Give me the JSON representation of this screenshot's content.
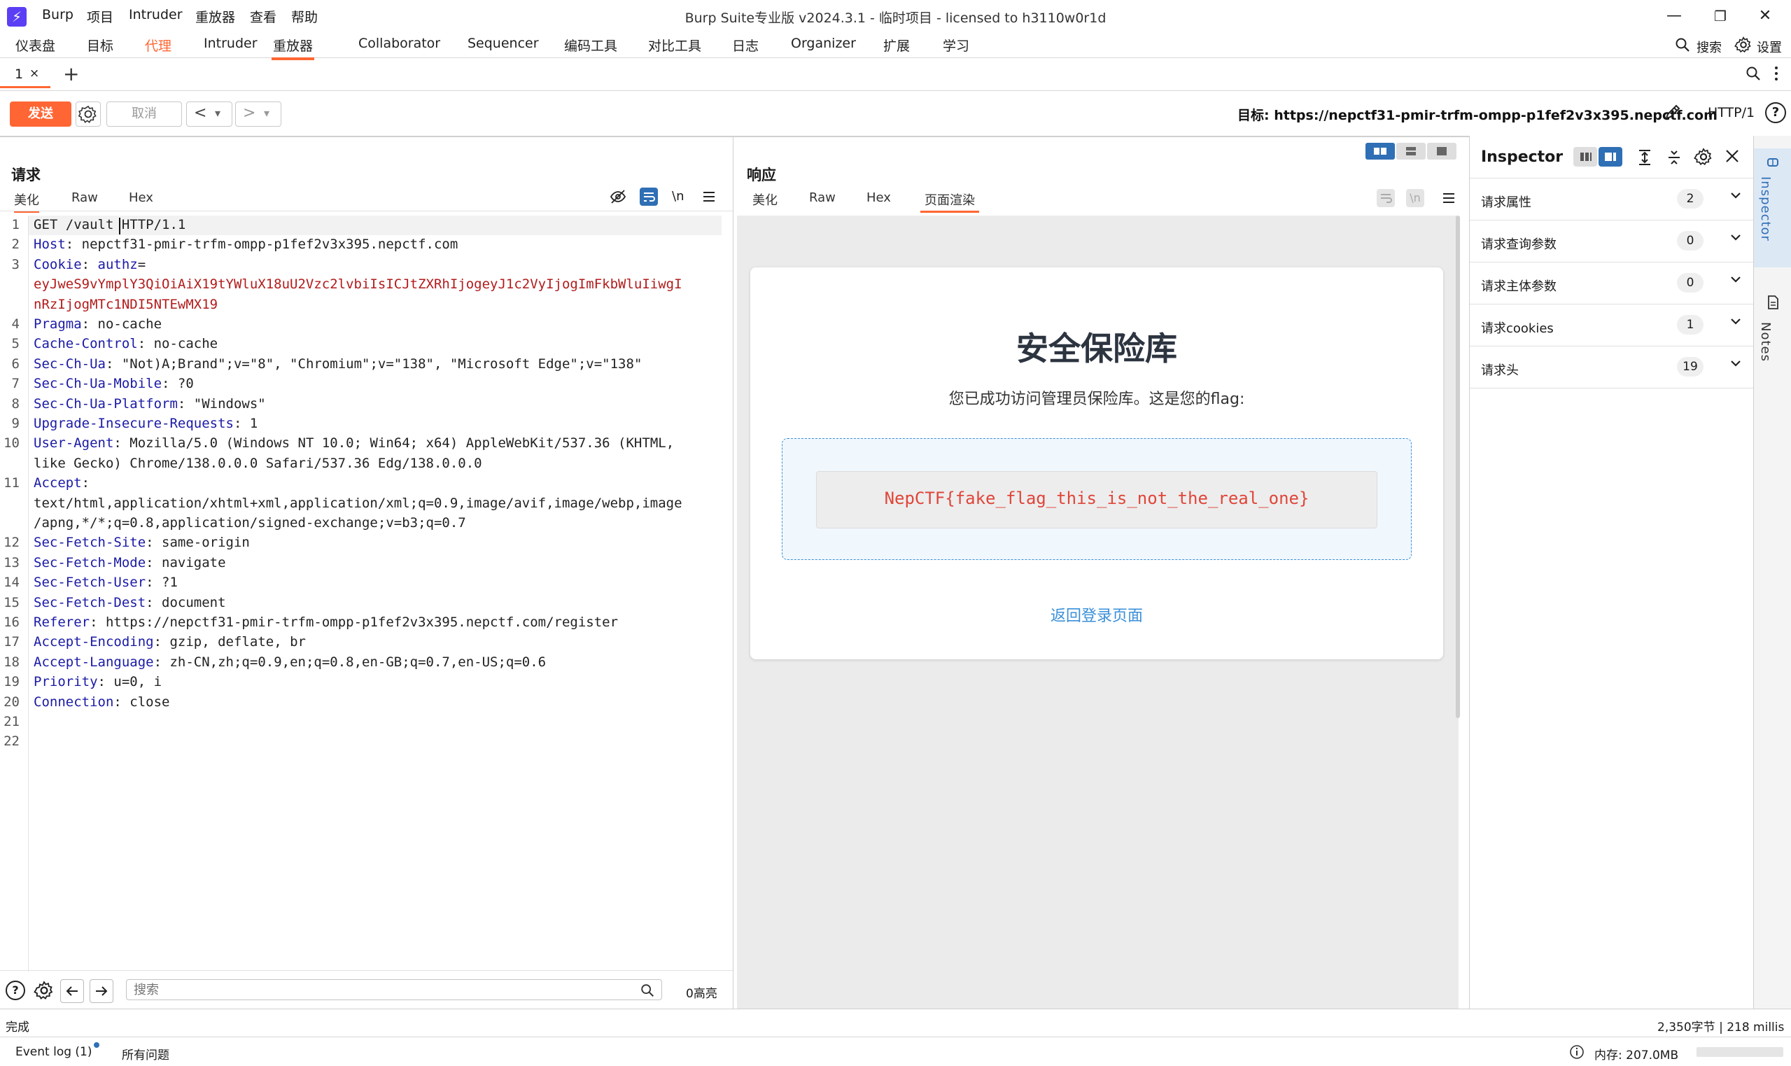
{
  "app": {
    "logo": "⚡",
    "window_title": "Burp Suite专业版  v2024.3.1 - 临时项目 - licensed to h3110w0r1d",
    "menu": [
      "Burp",
      "项目",
      "Intruder",
      "重放器",
      "查看",
      "帮助"
    ]
  },
  "window_controls": {
    "minimize": "—",
    "maximize": "❐",
    "close": "✕"
  },
  "main_tabs": {
    "items": [
      "仪表盘",
      "目标",
      "代理",
      "Intruder",
      "重放器",
      "Collaborator",
      "Sequencer",
      "编码工具",
      "对比工具",
      "日志",
      "Organizer",
      "扩展",
      "学习"
    ],
    "active": "重放器",
    "highlight": "代理",
    "search_label": "搜索",
    "settings_label": "设置"
  },
  "repeater_tabs": {
    "tab1": "1",
    "close": "×",
    "add": "+"
  },
  "toolbar": {
    "send": "发送",
    "cancel": "取消",
    "back": "<",
    "forward": ">",
    "dropdown": "▾",
    "target": "目标: https://nepctf31-pmir-trfm-ompp-p1fef2v3x395.nepctf.com",
    "http_version": "HTTP/1",
    "help": "?"
  },
  "request": {
    "title": "请求",
    "tabs": [
      "美化",
      "Raw",
      "Hex"
    ],
    "active_tab": "美化",
    "newline_toggle": "\\n",
    "lines": [
      {
        "n": "1",
        "key": "",
        "sep": "",
        "val": "GET /vault HTTP/1.1"
      },
      {
        "n": "2",
        "key": "Host",
        "sep": ": ",
        "val": "nepctf31-pmir-trfm-ompp-p1fef2v3x395.nepctf.com"
      },
      {
        "n": "3",
        "key": "Cookie",
        "sep": ": ",
        "val": "",
        "cookie_key": "authz",
        "cookie_eq": "="
      },
      {
        "n": "",
        "key": "",
        "sep": "",
        "val": "",
        "cookie_val": "eyJweS9vYmplY3QiOiAiX19tYWluX18uU2Vzc2lvbiIsICJtZXRhIjogeyJ1c2VyIjogImFkbWluIiwgI"
      },
      {
        "n": "",
        "key": "",
        "sep": "",
        "val": "",
        "cookie_val": "nRzIjogMTc1NDI5NTEwMX19"
      },
      {
        "n": "4",
        "key": "Pragma",
        "sep": ": ",
        "val": "no-cache"
      },
      {
        "n": "5",
        "key": "Cache-Control",
        "sep": ": ",
        "val": "no-cache"
      },
      {
        "n": "6",
        "key": "Sec-Ch-Ua",
        "sep": ": ",
        "val": "\"Not)A;Brand\";v=\"8\", \"Chromium\";v=\"138\", \"Microsoft Edge\";v=\"138\""
      },
      {
        "n": "7",
        "key": "Sec-Ch-Ua-Mobile",
        "sep": ": ",
        "val": "?0"
      },
      {
        "n": "8",
        "key": "Sec-Ch-Ua-Platform",
        "sep": ": ",
        "val": "\"Windows\""
      },
      {
        "n": "9",
        "key": "Upgrade-Insecure-Requests",
        "sep": ": ",
        "val": "1"
      },
      {
        "n": "10",
        "key": "User-Agent",
        "sep": ": ",
        "val": "Mozilla/5.0 (Windows NT 10.0; Win64; x64) AppleWebKit/537.36 (KHTML,"
      },
      {
        "n": "",
        "key": "",
        "sep": "",
        "val": "like Gecko) Chrome/138.0.0.0 Safari/537.36 Edg/138.0.0.0"
      },
      {
        "n": "11",
        "key": "Accept",
        "sep": ":",
        "val": ""
      },
      {
        "n": "",
        "key": "",
        "sep": "",
        "val": "text/html,application/xhtml+xml,application/xml;q=0.9,image/avif,image/webp,image"
      },
      {
        "n": "",
        "key": "",
        "sep": "",
        "val": "/apng,*/*;q=0.8,application/signed-exchange;v=b3;q=0.7"
      },
      {
        "n": "12",
        "key": "Sec-Fetch-Site",
        "sep": ": ",
        "val": "same-origin"
      },
      {
        "n": "13",
        "key": "Sec-Fetch-Mode",
        "sep": ": ",
        "val": "navigate"
      },
      {
        "n": "14",
        "key": "Sec-Fetch-User",
        "sep": ": ",
        "val": "?1"
      },
      {
        "n": "15",
        "key": "Sec-Fetch-Dest",
        "sep": ": ",
        "val": "document"
      },
      {
        "n": "16",
        "key": "Referer",
        "sep": ": ",
        "val": "https://nepctf31-pmir-trfm-ompp-p1fef2v3x395.nepctf.com/register"
      },
      {
        "n": "17",
        "key": "Accept-Encoding",
        "sep": ": ",
        "val": "gzip, deflate, br"
      },
      {
        "n": "18",
        "key": "Accept-Language",
        "sep": ": ",
        "val": "zh-CN,zh;q=0.9,en;q=0.8,en-GB;q=0.7,en-US;q=0.6"
      },
      {
        "n": "19",
        "key": "Priority",
        "sep": ": ",
        "val": "u=0, i"
      },
      {
        "n": "20",
        "key": "Connection",
        "sep": ": ",
        "val": "close"
      },
      {
        "n": "21",
        "key": "",
        "sep": "",
        "val": ""
      },
      {
        "n": "22",
        "key": "",
        "sep": "",
        "val": ""
      }
    ]
  },
  "response": {
    "title": "响应",
    "tabs": [
      "美化",
      "Raw",
      "Hex",
      "页面渲染"
    ],
    "active_tab": "页面渲染",
    "newline_toggle": "\\n",
    "rendered": {
      "heading": "安全保险库",
      "message": "您已成功访问管理员保险库。这是您的flag:",
      "flag": "NepCTF{fake_flag_this_is_not_the_real_one}",
      "back_link": "返回登录页面"
    }
  },
  "search_bar": {
    "placeholder": "搜索",
    "highlights": "0高亮",
    "help": "?"
  },
  "inspector": {
    "title": "Inspector",
    "rows": [
      {
        "label": "请求属性",
        "count": "2"
      },
      {
        "label": "请求查询参数",
        "count": "0"
      },
      {
        "label": "请求主体参数",
        "count": "0"
      },
      {
        "label": "请求cookies",
        "count": "1"
      },
      {
        "label": "请求头",
        "count": "19"
      }
    ]
  },
  "sidebar": {
    "inspector_label": "Inspector",
    "notes_label": "Notes"
  },
  "status": {
    "left": "完成",
    "right": "2,350字节 | 218 millis"
  },
  "footer": {
    "event_log": "Event log (1)",
    "all_issues": "所有问题",
    "memory": "内存: 207.0MB"
  },
  "colors": {
    "accent": "#ff6633",
    "send_button": "#ff6633",
    "header_key": "#1a1aa6",
    "cookie_value": "#b31b1b",
    "flag_text": "#e0463a",
    "link": "#3a8fd9",
    "toggle_active": "#2f6fb5"
  }
}
